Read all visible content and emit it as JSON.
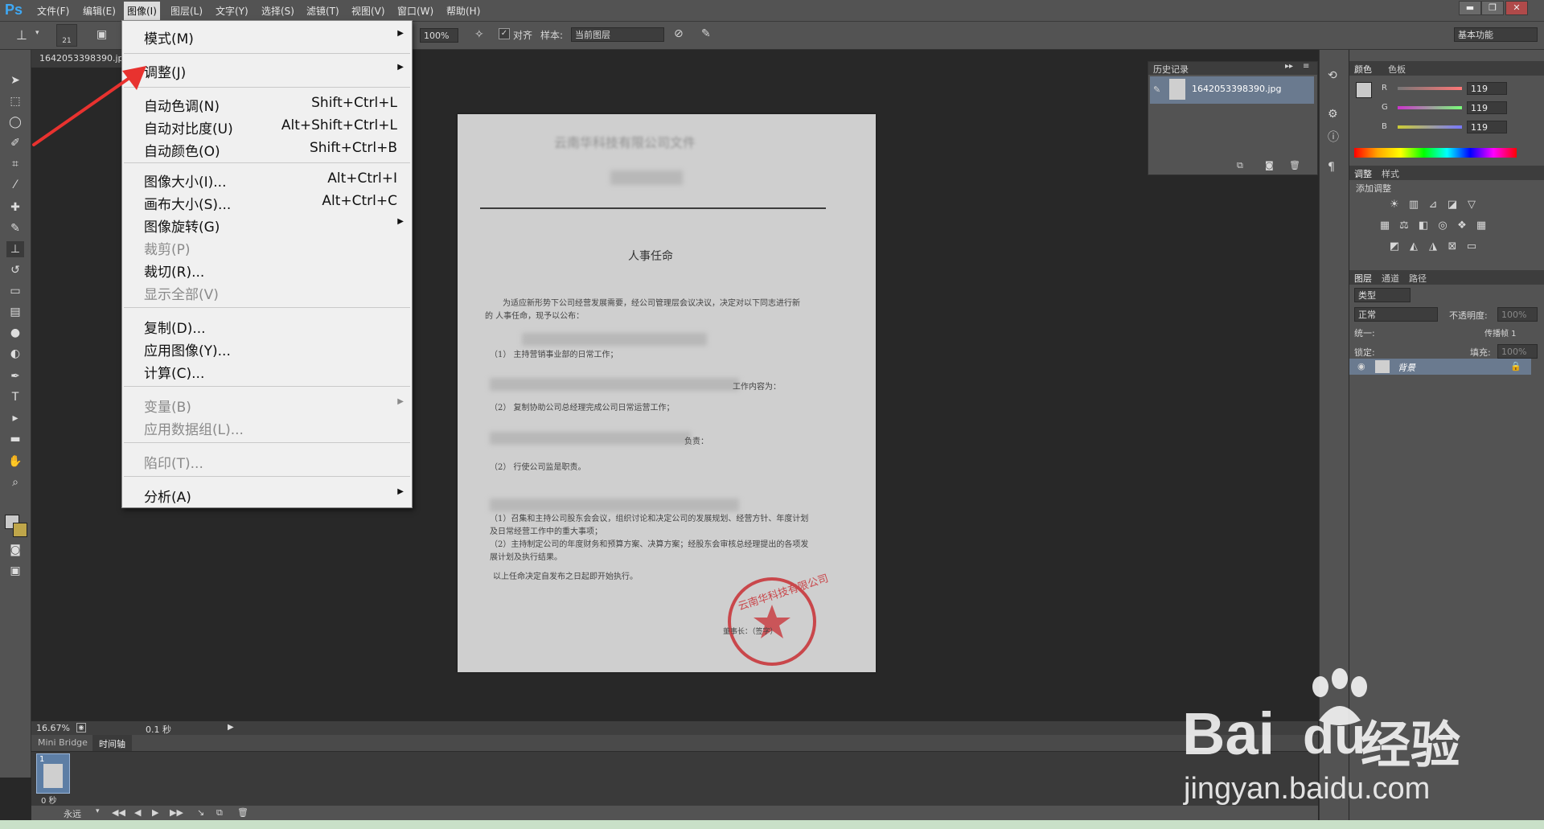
{
  "app": {
    "logo": "Ps"
  },
  "menubar": {
    "items": [
      "文件(F)",
      "编辑(E)",
      "图像(I)",
      "图层(L)",
      "文字(Y)",
      "选择(S)",
      "滤镜(T)",
      "视图(V)",
      "窗口(W)",
      "帮助(H)"
    ],
    "active_index": 2,
    "window_controls": [
      "▬",
      "❐",
      "✕"
    ]
  },
  "options_bar": {
    "brush_size": "21",
    "zoom": "100%",
    "align_label": "对齐",
    "sample_label": "样本:",
    "sample_value": "当前图层",
    "workspace": "基本功能"
  },
  "document": {
    "tab_title": "1642053398390.jp",
    "header_partial": "云南华科技有限公司文件",
    "title": "人事任命",
    "paragraph1a": "为适应新形势下公司经营发展需要，经公司管理层会议决议，决定对以下同志进行新",
    "paragraph1b": "的 人事任命，现予以公布：",
    "line_a": "（1）   主持营销事业部的日常工作；",
    "line_b": "工作内容为：",
    "line_c": "主持协助公司总经理完成公司日常运营工作；",
    "line_c2": "（2）  复制协助公司总经理完成公司日常运营工作；",
    "line_d": "负责：",
    "line_e": "（1）   公司日常运营维护；",
    "line_f": "（2）   行使公司监是职责。",
    "line_g": "（1）召集和主持公司股东会会议，组织讨论和决定公司的发展规划、经营方针、年度计划",
    "line_h": "及日常经营工作中的重大事项；",
    "line_i": "（2）主持制定公司的年度财务和预算方案、决算方案；经股东会审核总经理提出的各项发",
    "line_j": "展计划及执行结果。",
    "line_k": "以上任命决定自发布之日起即开始执行。",
    "stamp_text": "云南华科技有限公司",
    "sign_text": "董事长：（签字）"
  },
  "status": {
    "zoom": "16.67%",
    "time": "0.1 秒"
  },
  "timeline": {
    "tabs": [
      "Mini Bridge",
      "时间轴"
    ],
    "frame_number": "1",
    "frame_time": "0 秒",
    "loop": "永远"
  },
  "history": {
    "title": "历史记录",
    "item": "1642053398390.jpg"
  },
  "color_panel": {
    "tabs": [
      "颜色",
      "色板"
    ],
    "channels": [
      {
        "label": "R",
        "value": "119"
      },
      {
        "label": "G",
        "value": "119"
      },
      {
        "label": "B",
        "value": "119"
      }
    ]
  },
  "adjust_panel": {
    "tabs": [
      "调整",
      "样式"
    ],
    "title": "添加调整"
  },
  "layers_panel": {
    "tabs": [
      "图层",
      "通道",
      "路径"
    ],
    "kind": "类型",
    "blend": "正常",
    "opacity_label": "不透明度:",
    "opacity_value": "100%",
    "unify_label": "统一:",
    "propagate_label": "传播帧 1",
    "lock_label": "锁定:",
    "fill_label": "填充:",
    "fill_value": "100%",
    "layer_name": "背景"
  },
  "dropdown": {
    "items": [
      {
        "label": "模式(M)",
        "shortcut": "",
        "submenu": true,
        "disabled": false
      },
      {
        "label": "调整(J)",
        "shortcut": "",
        "submenu": true,
        "disabled": false
      },
      {
        "label": "自动色调(N)",
        "shortcut": "Shift+Ctrl+L",
        "submenu": false,
        "disabled": false
      },
      {
        "label": "自动对比度(U)",
        "shortcut": "Alt+Shift+Ctrl+L",
        "submenu": false,
        "disabled": false
      },
      {
        "label": "自动颜色(O)",
        "shortcut": "Shift+Ctrl+B",
        "submenu": false,
        "disabled": false
      },
      {
        "label": "图像大小(I)...",
        "shortcut": "Alt+Ctrl+I",
        "submenu": false,
        "disabled": false
      },
      {
        "label": "画布大小(S)...",
        "shortcut": "Alt+Ctrl+C",
        "submenu": false,
        "disabled": false
      },
      {
        "label": "图像旋转(G)",
        "shortcut": "",
        "submenu": true,
        "disabled": false
      },
      {
        "label": "裁剪(P)",
        "shortcut": "",
        "submenu": false,
        "disabled": true
      },
      {
        "label": "裁切(R)...",
        "shortcut": "",
        "submenu": false,
        "disabled": false
      },
      {
        "label": "显示全部(V)",
        "shortcut": "",
        "submenu": false,
        "disabled": true
      },
      {
        "label": "复制(D)...",
        "shortcut": "",
        "submenu": false,
        "disabled": false
      },
      {
        "label": "应用图像(Y)...",
        "shortcut": "",
        "submenu": false,
        "disabled": false
      },
      {
        "label": "计算(C)...",
        "shortcut": "",
        "submenu": false,
        "disabled": false
      },
      {
        "label": "变量(B)",
        "shortcut": "",
        "submenu": true,
        "disabled": true
      },
      {
        "label": "应用数据组(L)...",
        "shortcut": "",
        "submenu": false,
        "disabled": true
      },
      {
        "label": "陷印(T)...",
        "shortcut": "",
        "submenu": false,
        "disabled": true
      },
      {
        "label": "分析(A)",
        "shortcut": "",
        "submenu": true,
        "disabled": false
      }
    ]
  },
  "watermark": {
    "brand": "Bai",
    "brand2": "du",
    "brand_cn": "经验",
    "url": "jingyan.baidu.com"
  },
  "colors": {
    "accent": "#3fa9f5",
    "stamp": "#c9474b",
    "arrow": "#e8322f"
  }
}
